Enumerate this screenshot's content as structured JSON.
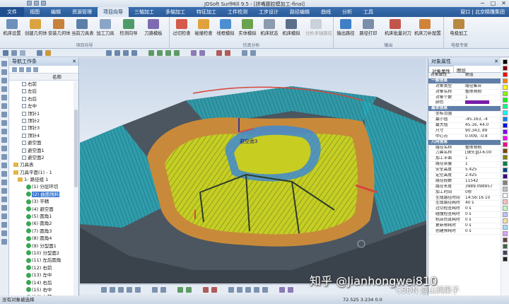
{
  "window": {
    "title": "JDSoft SurfMill 9.5 - [拼嘴腹腔模加工-final]",
    "controls": [
      "−",
      "□",
      "✕"
    ]
  },
  "menu": {
    "items": [
      "文件",
      "视图",
      "编辑",
      "资源管理",
      "项目向导",
      "三轴加工",
      "多轴加工",
      "特征加工",
      "工件检测",
      "工步设计",
      "路径编辑",
      "曲线",
      "分析",
      "工具"
    ],
    "active": "项目向导",
    "right_label": "窗口 | 北京精雕集团"
  },
  "ribbon": {
    "groups": [
      {
        "label": "项目向导",
        "buttons": [
          "机床设置",
          "创建几何体",
          "安装几何体",
          "当前刀具表",
          "加工刀具",
          "检测向导",
          "刀路模板"
        ]
      },
      {
        "label": "仿真分析",
        "buttons": [
          "过切检查",
          "碰撞检查",
          "线框模拟",
          "实体模拟",
          "机床状态",
          "机床模拟",
          "分析多轴路径"
        ]
      },
      {
        "label": "输出",
        "buttons": [
          "输出路径",
          "路径打印",
          "机床批量对刀",
          "机床刀补配置"
        ]
      },
      {
        "label": "电极专家",
        "buttons": [
          "电极加工"
        ]
      }
    ]
  },
  "nav_panel": {
    "title": "导航工作条",
    "column": "名称",
    "rows": [
      {
        "text": "右前",
        "kind": "box",
        "indent": 18
      },
      {
        "text": "左后",
        "kind": "box",
        "indent": 18
      },
      {
        "text": "右后",
        "kind": "box",
        "indent": 18
      },
      {
        "text": "左中",
        "kind": "box",
        "indent": 18
      },
      {
        "text": "顶针1",
        "kind": "box",
        "indent": 18
      },
      {
        "text": "顶针2",
        "kind": "box",
        "indent": 18
      },
      {
        "text": "顶针3",
        "kind": "box",
        "indent": 18
      },
      {
        "text": "顶针4",
        "kind": "box",
        "indent": 18
      },
      {
        "text": "避空面",
        "kind": "box",
        "indent": 18
      },
      {
        "text": "避空面1",
        "kind": "box",
        "indent": 18
      },
      {
        "text": "避空面2",
        "kind": "box",
        "indent": 18
      },
      {
        "text": "刀具表",
        "kind": "folder",
        "indent": 6
      },
      {
        "text": "刀具平面(1) - 1",
        "kind": "folder",
        "indent": 6
      },
      {
        "text": "1- 路径组 1",
        "kind": "folder",
        "indent": 12
      },
      {
        "text": "(1) 分层环切",
        "kind": "ok",
        "indent": 24
      },
      {
        "text": "(2) 曲面残料",
        "kind": "ok",
        "indent": 24,
        "selected": true
      },
      {
        "text": "(3) 平精",
        "kind": "ok",
        "indent": 24
      },
      {
        "text": "(4) 避空面",
        "kind": "ok",
        "indent": 24
      },
      {
        "text": "(5) 圆角1",
        "kind": "ok",
        "indent": 24
      },
      {
        "text": "(6) 圆角2",
        "kind": "ok",
        "indent": 24
      },
      {
        "text": "(7) 圆角3",
        "kind": "ok",
        "indent": 24
      },
      {
        "text": "(8) 圆角4",
        "kind": "ok",
        "indent": 24
      },
      {
        "text": "(9) 分型面1",
        "kind": "ok",
        "indent": 24
      },
      {
        "text": "(10) 分型面2",
        "kind": "ok",
        "indent": 24
      },
      {
        "text": "(11) 左后圆角",
        "kind": "ok",
        "indent": 24
      },
      {
        "text": "(12) 右前",
        "kind": "ok",
        "indent": 24
      },
      {
        "text": "(13) 左中",
        "kind": "ok",
        "indent": 24
      },
      {
        "text": "(14) 右后",
        "kind": "ok",
        "indent": 24
      },
      {
        "text": "(15) 右中",
        "kind": "ok",
        "indent": 24
      },
      {
        "text": "(16) 左前",
        "kind": "ok",
        "indent": 24
      }
    ]
  },
  "viewport": {
    "label": "避空面3"
  },
  "props": {
    "title": "对象属性",
    "tabs": [
      "对象属性",
      "图层"
    ],
    "header": [
      "对象属性",
      "数值"
    ],
    "rows": [
      {
        "k": "一般信息",
        "v": "",
        "type": "sec"
      },
      {
        "k": "对象类型",
        "v": "路径集合"
      },
      {
        "k": "对象名称",
        "v": "整体预削"
      },
      {
        "k": "对象个数",
        "v": "1"
      },
      {
        "k": "颜色",
        "v": "",
        "type": "color"
      },
      {
        "k": "基本信息",
        "v": "",
        "type": "sec"
      },
      {
        "k": "坐标范围",
        "v": ""
      },
      {
        "k": "最小值",
        "v": "-45.163, -4"
      },
      {
        "k": "最大值",
        "v": "45.16, 44.0"
      },
      {
        "k": "尺寸",
        "v": "90.343, 89"
      },
      {
        "k": "中心点",
        "v": "0.009, -0.8"
      },
      {
        "k": "几何信息",
        "v": "",
        "type": "sec"
      },
      {
        "k": "路径名称",
        "v": "整体预削"
      },
      {
        "k": "刀具名称",
        "v": "[球头]JD-6.00"
      },
      {
        "k": "加工平面",
        "v": "1"
      },
      {
        "k": "路径余量",
        "v": "1"
      },
      {
        "k": "安全高度",
        "v": "5.425"
      },
      {
        "k": "定位高度",
        "v": "2.425"
      },
      {
        "k": "路径段数",
        "v": "11542"
      },
      {
        "k": "路径长度",
        "v": "3989.098957"
      },
      {
        "k": "加工时间",
        "v": "0秒"
      },
      {
        "k": "生成路径时间",
        "v": "14:56:16 10"
      },
      {
        "k": "生成路径耗时",
        "v": "40 s"
      },
      {
        "k": "过切检查耗时",
        "v": "0 s"
      },
      {
        "k": "碰撞检查耗时",
        "v": "0 s"
      },
      {
        "k": "机床仿真耗时",
        "v": "0 s"
      },
      {
        "k": "更新预耗时",
        "v": "0 s"
      },
      {
        "k": "创建预耗时",
        "v": "0 s"
      }
    ]
  },
  "status": {
    "message": "没有对象被选择",
    "coords": "72.525 3.234 0.0"
  },
  "watermark": {
    "line1": "知乎 @Jianhongwei810",
    "line2": "CSDN @山涧果子"
  },
  "colors": {
    "menubar": "#2a5a98",
    "accent": "#3a78d0",
    "toolpath_yellow": "#d8d21f",
    "toolpath_cyan": "#2fb7c9",
    "part_dark": "#4b5660"
  }
}
